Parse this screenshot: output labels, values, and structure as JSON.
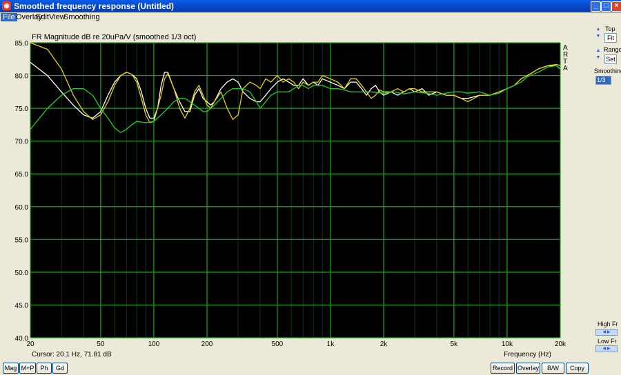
{
  "window": {
    "title": "Smoothed frequency response (Untitled)",
    "app_icon": "arta-icon",
    "controls": [
      "minimize-icon",
      "maximize-icon",
      "close-icon"
    ]
  },
  "menu": {
    "items": [
      "File",
      "Overlay",
      "Edit",
      "View",
      "Smoothing"
    ],
    "active": "File"
  },
  "plot": {
    "title": "FR Magnitude dB re 20uPa/V  (smoothed 1/3 oct)",
    "watermark": [
      "A",
      "R",
      "T",
      "A"
    ],
    "cursor_text": "Cursor: 20.1 Hz, 71.81 dB",
    "xlabel": "Frequency (Hz)"
  },
  "chart_data": {
    "type": "line",
    "x_scale": "log",
    "xlim": [
      20,
      20000
    ],
    "ylim": [
      40,
      85
    ],
    "x_ticks": [
      20,
      50,
      100,
      200,
      500,
      1000,
      2000,
      5000,
      10000,
      20000
    ],
    "x_tick_labels": [
      "20",
      "50",
      "100",
      "200",
      "500",
      "1k",
      "2k",
      "5k",
      "10k",
      "20k"
    ],
    "y_ticks": [
      40,
      45,
      50,
      55,
      60,
      65,
      70,
      75,
      80,
      85
    ],
    "y_tick_labels": [
      "40.0",
      "45.0",
      "50.0",
      "55.0",
      "60.0",
      "65.0",
      "70.0",
      "75.0",
      "80.0",
      "85.0"
    ],
    "xlabel": "Frequency (Hz)",
    "title": "FR Magnitude dB re 20uPa/V  (smoothed 1/3 oct)",
    "grid": true,
    "background": "#000000",
    "grid_color": "#1aa81a",
    "series": [
      {
        "color": "#ffffff",
        "points": [
          [
            20,
            82
          ],
          [
            25,
            80
          ],
          [
            30,
            77.5
          ],
          [
            35,
            75.5
          ],
          [
            40,
            74
          ],
          [
            45,
            73.5
          ],
          [
            50,
            74.5
          ],
          [
            55,
            77
          ],
          [
            60,
            79
          ],
          [
            65,
            80
          ],
          [
            70,
            80.5
          ],
          [
            75,
            80.2
          ],
          [
            80,
            79.5
          ],
          [
            85,
            77.5
          ],
          [
            90,
            75
          ],
          [
            95,
            73.5
          ],
          [
            100,
            73.5
          ],
          [
            105,
            75
          ],
          [
            110,
            78.5
          ],
          [
            115,
            80.5
          ],
          [
            120,
            80.5
          ],
          [
            130,
            78
          ],
          [
            140,
            76
          ],
          [
            150,
            74.5
          ],
          [
            160,
            74.5
          ],
          [
            170,
            77
          ],
          [
            180,
            78
          ],
          [
            190,
            76.5
          ],
          [
            200,
            76
          ],
          [
            210,
            75.5
          ],
          [
            220,
            76
          ],
          [
            240,
            78
          ],
          [
            260,
            79
          ],
          [
            280,
            79.5
          ],
          [
            300,
            79
          ],
          [
            320,
            77.5
          ],
          [
            350,
            76.5
          ],
          [
            380,
            76
          ],
          [
            400,
            76
          ],
          [
            430,
            77
          ],
          [
            460,
            78
          ],
          [
            500,
            79
          ],
          [
            540,
            79.5
          ],
          [
            580,
            79
          ],
          [
            620,
            78.5
          ],
          [
            660,
            78.5
          ],
          [
            700,
            79.5
          ],
          [
            750,
            78.5
          ],
          [
            800,
            79
          ],
          [
            850,
            78.5
          ],
          [
            900,
            79.5
          ],
          [
            1000,
            79
          ],
          [
            1100,
            78.5
          ],
          [
            1200,
            78
          ],
          [
            1300,
            79
          ],
          [
            1400,
            79
          ],
          [
            1500,
            78
          ],
          [
            1600,
            77
          ],
          [
            1700,
            78
          ],
          [
            1800,
            78.5
          ],
          [
            1900,
            77.5
          ],
          [
            2000,
            77
          ],
          [
            2200,
            77.5
          ],
          [
            2400,
            77
          ],
          [
            2600,
            77.5
          ],
          [
            2800,
            78
          ],
          [
            3000,
            77.5
          ],
          [
            3300,
            78
          ],
          [
            3600,
            77
          ],
          [
            4000,
            77.5
          ],
          [
            4500,
            77
          ],
          [
            5000,
            77
          ],
          [
            5500,
            76.5
          ],
          [
            6000,
            76.5
          ],
          [
            7000,
            77
          ],
          [
            8000,
            77
          ],
          [
            9000,
            77.5
          ],
          [
            10000,
            78
          ],
          [
            11000,
            78.5
          ],
          [
            12000,
            79.5
          ],
          [
            13000,
            80
          ],
          [
            14000,
            80.5
          ],
          [
            15000,
            81
          ],
          [
            17000,
            81.5
          ],
          [
            19000,
            81.5
          ],
          [
            20000,
            81
          ]
        ]
      },
      {
        "color": "#e8d200",
        "points": [
          [
            20,
            85
          ],
          [
            25,
            84
          ],
          [
            30,
            81
          ],
          [
            35,
            77
          ],
          [
            40,
            74.5
          ],
          [
            45,
            73.3
          ],
          [
            50,
            74
          ],
          [
            55,
            76
          ],
          [
            60,
            78.5
          ],
          [
            65,
            80
          ],
          [
            70,
            80.5
          ],
          [
            75,
            80.2
          ],
          [
            80,
            79
          ],
          [
            85,
            76.5
          ],
          [
            90,
            74
          ],
          [
            95,
            72.8
          ],
          [
            100,
            73
          ],
          [
            105,
            75
          ],
          [
            110,
            77
          ],
          [
            115,
            79.5
          ],
          [
            120,
            80.3
          ],
          [
            130,
            78
          ],
          [
            140,
            75
          ],
          [
            150,
            73.5
          ],
          [
            160,
            75
          ],
          [
            170,
            77.5
          ],
          [
            180,
            78.5
          ],
          [
            190,
            77
          ],
          [
            200,
            75.5
          ],
          [
            210,
            75
          ],
          [
            220,
            76
          ],
          [
            240,
            77.5
          ],
          [
            260,
            75
          ],
          [
            280,
            73.3
          ],
          [
            300,
            74
          ],
          [
            320,
            78
          ],
          [
            350,
            79
          ],
          [
            380,
            78.5
          ],
          [
            400,
            78
          ],
          [
            430,
            79.5
          ],
          [
            460,
            79
          ],
          [
            500,
            80
          ],
          [
            540,
            79
          ],
          [
            580,
            79.5
          ],
          [
            620,
            79
          ],
          [
            660,
            78
          ],
          [
            700,
            79
          ],
          [
            750,
            78.5
          ],
          [
            800,
            79
          ],
          [
            850,
            79
          ],
          [
            900,
            80
          ],
          [
            1000,
            79.5
          ],
          [
            1100,
            79
          ],
          [
            1200,
            78
          ],
          [
            1300,
            79.5
          ],
          [
            1400,
            79.5
          ],
          [
            1500,
            78.5
          ],
          [
            1600,
            77.5
          ],
          [
            1700,
            76.5
          ],
          [
            1800,
            77
          ],
          [
            1900,
            77.8
          ],
          [
            2000,
            77.5
          ],
          [
            2200,
            77.5
          ],
          [
            2400,
            78
          ],
          [
            2600,
            77.5
          ],
          [
            2800,
            78
          ],
          [
            3000,
            78
          ],
          [
            3300,
            77.5
          ],
          [
            3600,
            77.5
          ],
          [
            4000,
            77.5
          ],
          [
            4500,
            77
          ],
          [
            5000,
            77
          ],
          [
            5500,
            76.5
          ],
          [
            6000,
            76
          ],
          [
            7000,
            77
          ],
          [
            8000,
            77
          ],
          [
            9000,
            77.5
          ],
          [
            10000,
            78
          ],
          [
            11000,
            78.5
          ],
          [
            12000,
            79.5
          ],
          [
            13000,
            80
          ],
          [
            14000,
            80.5
          ],
          [
            15000,
            81
          ],
          [
            17000,
            81.5
          ],
          [
            19000,
            81.7
          ],
          [
            20000,
            81.5
          ]
        ]
      },
      {
        "color": "#22d122",
        "points": [
          [
            20,
            71.8
          ],
          [
            25,
            75
          ],
          [
            30,
            77
          ],
          [
            35,
            78
          ],
          [
            40,
            78
          ],
          [
            45,
            77
          ],
          [
            50,
            75
          ],
          [
            55,
            73.5
          ],
          [
            60,
            72
          ],
          [
            65,
            71.3
          ],
          [
            70,
            71.8
          ],
          [
            75,
            72.5
          ],
          [
            80,
            73
          ],
          [
            90,
            72.8
          ],
          [
            100,
            73
          ],
          [
            110,
            74
          ],
          [
            120,
            75
          ],
          [
            130,
            76
          ],
          [
            140,
            76.5
          ],
          [
            150,
            76.5
          ],
          [
            160,
            76
          ],
          [
            170,
            75.5
          ],
          [
            180,
            75
          ],
          [
            190,
            74.5
          ],
          [
            200,
            74.5
          ],
          [
            220,
            75.5
          ],
          [
            240,
            76.5
          ],
          [
            260,
            77.5
          ],
          [
            280,
            78
          ],
          [
            300,
            78
          ],
          [
            320,
            78
          ],
          [
            350,
            77.5
          ],
          [
            380,
            76
          ],
          [
            400,
            75
          ],
          [
            430,
            76
          ],
          [
            460,
            77
          ],
          [
            500,
            77.5
          ],
          [
            540,
            77.5
          ],
          [
            580,
            77.5
          ],
          [
            620,
            78
          ],
          [
            660,
            78.5
          ],
          [
            700,
            78.5
          ],
          [
            750,
            78
          ],
          [
            800,
            78.5
          ],
          [
            900,
            78.5
          ],
          [
            1000,
            78
          ],
          [
            1100,
            78
          ],
          [
            1200,
            77.8
          ],
          [
            1300,
            77.5
          ],
          [
            1500,
            77.5
          ],
          [
            1700,
            77.5
          ],
          [
            2000,
            77.3
          ],
          [
            2300,
            77.5
          ],
          [
            2600,
            77.2
          ],
          [
            3000,
            77.5
          ],
          [
            3500,
            77.3
          ],
          [
            4000,
            77
          ],
          [
            4500,
            77.3
          ],
          [
            5000,
            77.5
          ],
          [
            5500,
            77.5
          ],
          [
            6000,
            77.3
          ],
          [
            7000,
            77.5
          ],
          [
            8000,
            77
          ],
          [
            9000,
            77.3
          ],
          [
            10000,
            78
          ],
          [
            11000,
            78.5
          ],
          [
            12000,
            79
          ],
          [
            13000,
            79.8
          ],
          [
            14000,
            80.2
          ],
          [
            15000,
            80.5
          ],
          [
            17000,
            81.3
          ],
          [
            19000,
            81.5
          ],
          [
            20000,
            81
          ]
        ]
      }
    ]
  },
  "sidebar": {
    "top_label": "Top",
    "fit_label": "Fit",
    "range_label": "Range",
    "set_label": "Set",
    "smoothing_label": "Smoothing",
    "smoothing_value": "1/3",
    "high_fr_label": "High Fr",
    "low_fr_label": "Low Fr"
  },
  "bottom": {
    "left_buttons": [
      "Mag",
      "M+P",
      "Ph",
      "Gd"
    ],
    "right_buttons": [
      "Record",
      "Overlay",
      "B/W",
      "Copy"
    ]
  }
}
